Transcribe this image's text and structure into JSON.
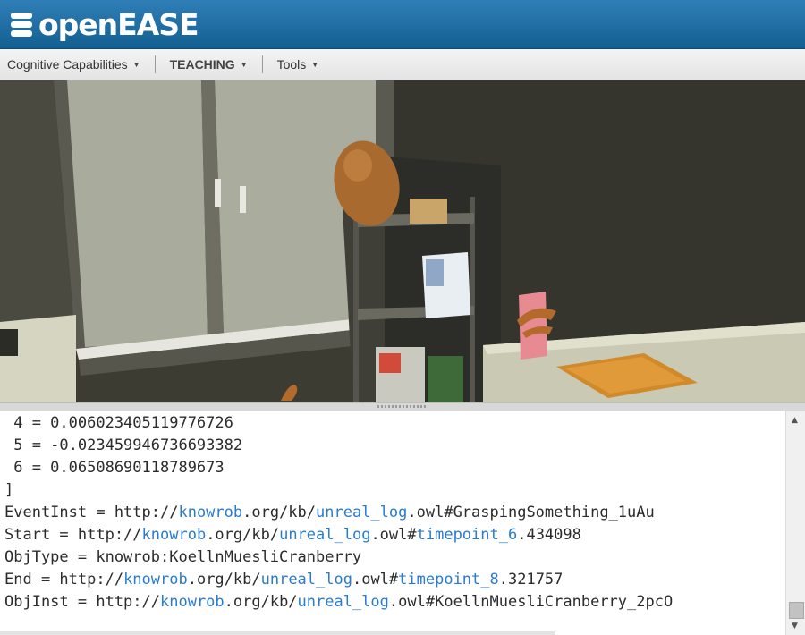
{
  "app": {
    "title": "openEASE"
  },
  "menu": {
    "items": [
      {
        "label": "Cognitive Capabilities"
      },
      {
        "label": "TEACHING"
      },
      {
        "label": "Tools"
      }
    ]
  },
  "console": {
    "lines": [
      " 4 = 0.006023405119776726",
      " 5 = -0.023459946736693382",
      " 6 = 0.06508690118789673",
      "]"
    ],
    "event": {
      "prefix": "EventInst = http://",
      "host": "knowrob",
      "mid": ".org/kb/",
      "file": "unreal_log",
      "ext": ".owl#",
      "frag": "GraspingSomething_1uAu"
    },
    "start": {
      "prefix": "Start = http://",
      "host": "knowrob",
      "mid": ".org/kb/",
      "file": "unreal_log",
      "ext": ".owl#",
      "frag": "timepoint_6",
      "rest": ".434098"
    },
    "objtype": "ObjType = knowrob:KoellnMuesliCranberry",
    "end": {
      "prefix": "End = http://",
      "host": "knowrob",
      "mid": ".org/kb/",
      "file": "unreal_log",
      "ext": ".owl#",
      "frag": "timepoint_8",
      "rest": ".321757"
    },
    "objinst": {
      "prefix": "ObjInst = http://",
      "host": "knowrob",
      "mid": ".org/kb/",
      "file": "unreal_log",
      "ext": ".owl#",
      "frag": "KoellnMuesliCranberry_2pcO"
    }
  },
  "icons": {
    "logo": "stack-logo-icon",
    "scroll_up": "triangle-up-icon",
    "scroll_down": "triangle-down-icon"
  },
  "colors": {
    "header": "#1f6fa6",
    "link": "#2a7bd0",
    "text": "#2b2b2b"
  }
}
